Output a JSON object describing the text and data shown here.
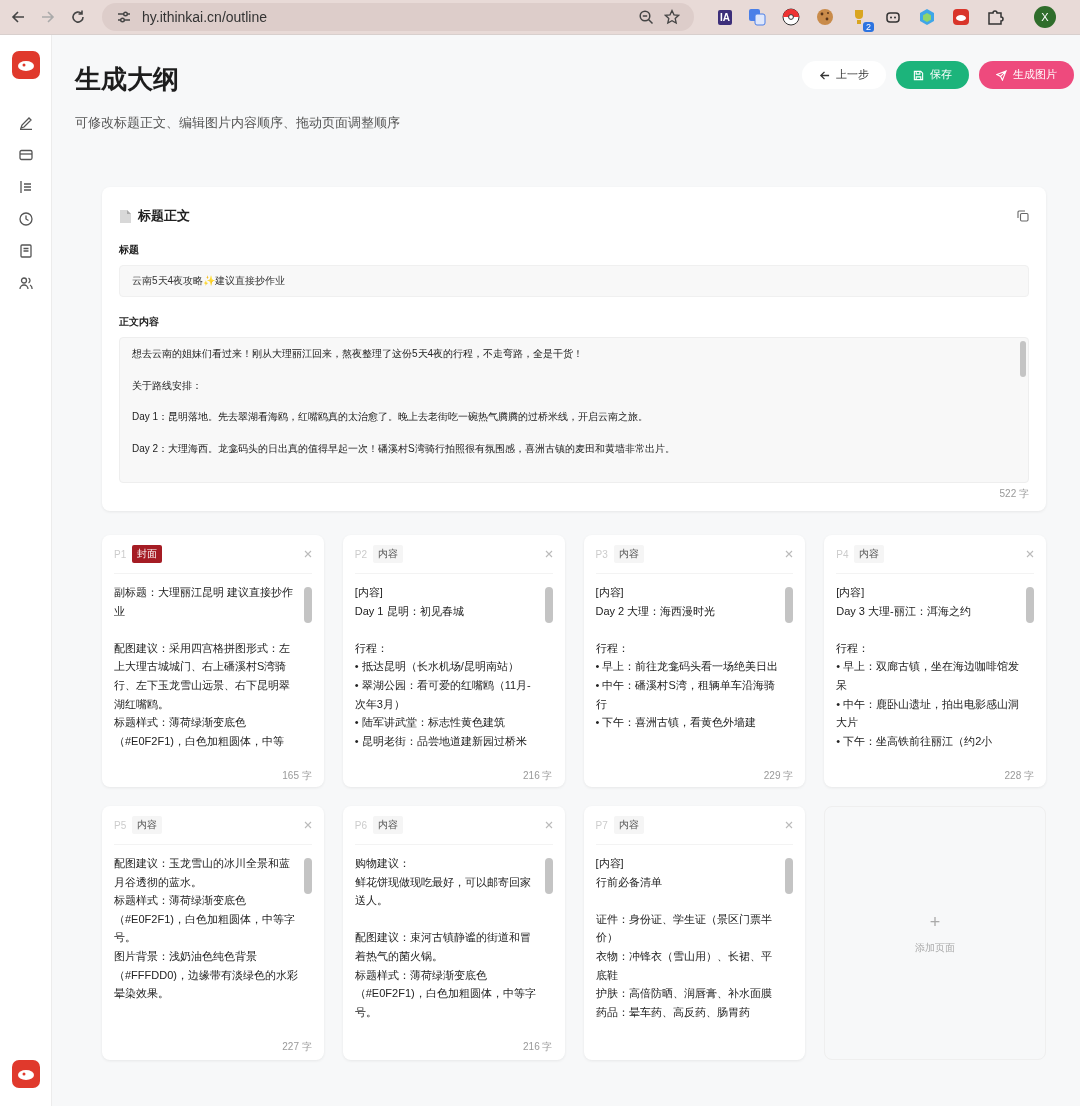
{
  "browser": {
    "url": "hy.ithinkai.cn/outline",
    "extension_label": "IA",
    "extension_badge": "2",
    "profile_initial": "X"
  },
  "header": {
    "title": "生成大纲",
    "subtitle": "可修改标题正文、编辑图片内容顺序、拖动页面调整顺序",
    "buttons": [
      {
        "label": "上一步",
        "kind": "back"
      },
      {
        "label": "保存",
        "kind": "save"
      },
      {
        "label": "生成图片",
        "kind": "generate"
      }
    ]
  },
  "main_card": {
    "heading": "标题正文",
    "title_label": "标题",
    "title_value": "云南5天4夜攻略✨建议直接抄作业",
    "body_label": "正文内容",
    "body_paragraphs": [
      "想去云南的姐妹们看过来！刚从大理丽江回来，熬夜整理了这份5天4夜的行程，不走弯路，全是干货！",
      "关于路线安排：",
      "Day 1：昆明落地。先去翠湖看海鸥，红嘴鸥真的太治愈了。晚上去老街吃一碗热气腾腾的过桥米线，开启云南之旅。",
      "Day 2：大理海西。龙龛码头的日出真的值得早起一次！磻溪村S湾骑行拍照很有氛围感，喜洲古镇的麦田和黄墙非常出片。"
    ],
    "count": "522 字"
  },
  "pages": [
    {
      "number": "P1",
      "tag": "封面",
      "kind": "cover",
      "paragraphs": [
        [
          "副标题：大理丽江昆明 建议直接抄作业"
        ],
        [
          "配图建议：采用四宫格拼图形式：左上大理古城城门、右上磻溪村S湾骑行、左下玉龙雪山远景、右下昆明翠湖红嘴鸥。",
          "标题样式：薄荷绿渐变底色（#E0F2F1)，白色加粗圆体，中等"
        ]
      ],
      "count": "165 字"
    },
    {
      "number": "P2",
      "tag": "内容",
      "kind": "content",
      "paragraphs": [
        [
          "[内容]",
          "Day 1 昆明：初见春城"
        ],
        [
          "行程：",
          "• 抵达昆明（长水机场/昆明南站）",
          "• 翠湖公园：看可爱的红嘴鸥（11月-次年3月）",
          "• 陆军讲武堂：标志性黄色建筑",
          "• 昆明老街：品尝地道建新园过桥米"
        ]
      ],
      "count": "216 字"
    },
    {
      "number": "P3",
      "tag": "内容",
      "kind": "content",
      "paragraphs": [
        [
          "[内容]",
          "Day 2 大理：海西漫时光"
        ],
        [
          "行程：",
          "• 早上：前往龙龛码头看一场绝美日出",
          "• 中午：磻溪村S湾，租辆单车沿海骑行",
          "• 下午：喜洲古镇，看黄色外墙建"
        ]
      ],
      "count": "229 字"
    },
    {
      "number": "P4",
      "tag": "内容",
      "kind": "content",
      "paragraphs": [
        [
          "[内容]",
          "Day 3 大理-丽江：洱海之约"
        ],
        [
          "行程：",
          "• 早上：双廊古镇，坐在海边咖啡馆发呆",
          "• 中午：鹿卧山遗址，拍出电影感山洞大片",
          "• 下午：坐高铁前往丽江（约2小"
        ]
      ],
      "count": "228 字"
    },
    {
      "number": "P5",
      "tag": "内容",
      "kind": "content",
      "paragraphs": [
        [
          "配图建议：玉龙雪山的冰川全景和蓝月谷透彻的蓝水。",
          "标题样式：薄荷绿渐变底色（#E0F2F1)，白色加粗圆体，中等字号。",
          "图片背景：浅奶油色纯色背景（#FFFDD0)，边缘带有淡绿色的水彩晕染效果。"
        ]
      ],
      "count": "227 字"
    },
    {
      "number": "P6",
      "tag": "内容",
      "kind": "content",
      "paragraphs": [
        [
          "购物建议：",
          "鲜花饼现做现吃最好，可以邮寄回家送人。"
        ],
        [
          "配图建议：束河古镇静谧的街道和冒着热气的菌火锅。",
          "标题样式：薄荷绿渐变底色（#E0F2F1)，白色加粗圆体，中等字号。"
        ]
      ],
      "count": "216 字"
    },
    {
      "number": "P7",
      "tag": "内容",
      "kind": "content",
      "paragraphs": [
        [
          "[内容]",
          "行前必备清单"
        ],
        [
          "证件：身份证、学生证（景区门票半价）",
          "衣物：冲锋衣（雪山用）、长裙、平底鞋",
          "护肤：高倍防晒、润唇膏、补水面膜",
          "药品：晕车药、高反药、肠胃药"
        ]
      ]
    }
  ],
  "add_page": {
    "icon_text": "+",
    "label": "添加页面"
  }
}
